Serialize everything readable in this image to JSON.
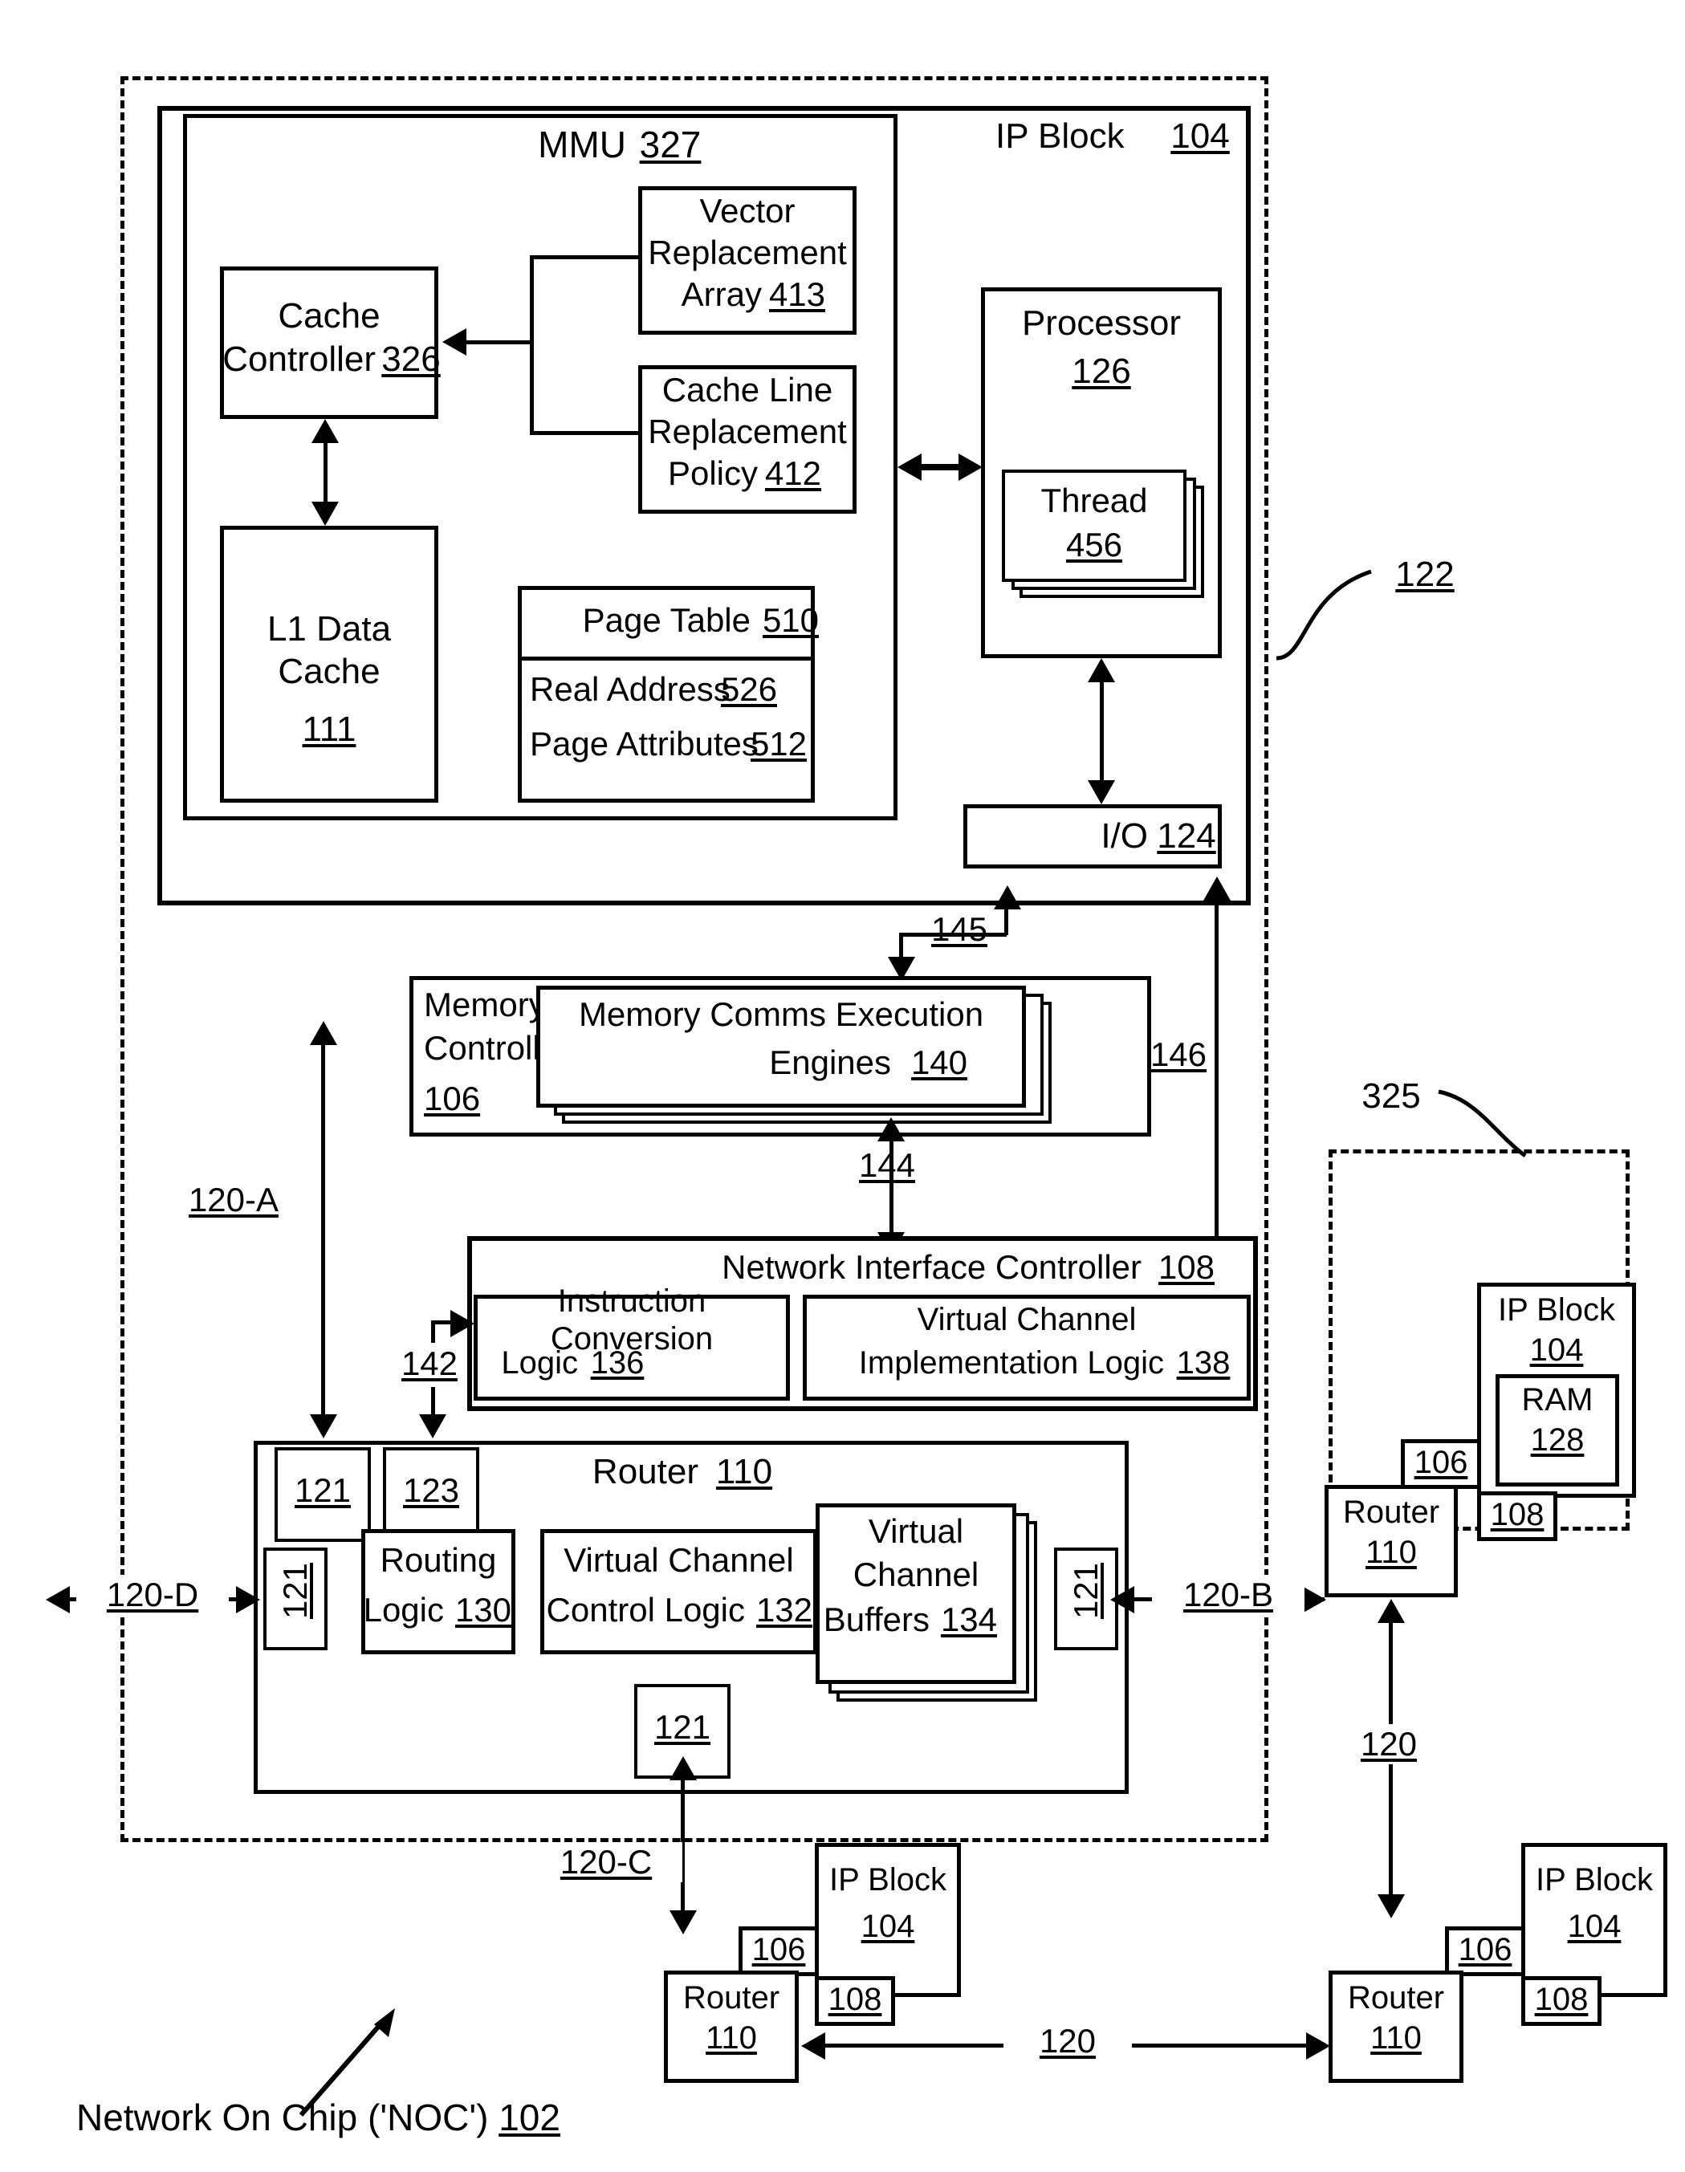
{
  "figure": {
    "caption": "Network On Chip ('NOC') 102",
    "noc_ref": "102"
  },
  "noc_boundary": {
    "name": "NOC dashed boundary"
  },
  "ip_block_main": {
    "title": "IP Block",
    "ref": "104",
    "pointer_ref": "122"
  },
  "mmu": {
    "title": "MMU",
    "ref": "327",
    "cache_controller": {
      "line1": "Cache",
      "line2": "Controller",
      "ref": "326"
    },
    "l1_cache": {
      "line1": "L1 Data",
      "line2": "Cache",
      "ref": "111"
    },
    "vector_replacement_array": {
      "line1": "Vector",
      "line2": "Replacement",
      "line3": "Array",
      "ref": "413"
    },
    "cache_line_replacement_policy": {
      "line1": "Cache Line",
      "line2": "Replacement",
      "line3": "Policy",
      "ref": "412"
    },
    "page_table": {
      "title": "Page Table",
      "ref": "510",
      "rows": [
        {
          "label": "Real Address",
          "ref": "526"
        },
        {
          "label": "Page Attributes",
          "ref": "512"
        }
      ]
    }
  },
  "processor": {
    "title": "Processor",
    "ref": "126",
    "thread": {
      "title": "Thread",
      "ref": "456"
    }
  },
  "io": {
    "title": "I/O",
    "ref": "124"
  },
  "memory_comms_controller": {
    "line1": "Memory Comms",
    "line2": "Controller",
    "ref": "106",
    "engines": {
      "line1": "Memory Comms Execution",
      "line2": "Engines",
      "ref": "140"
    }
  },
  "network_interface_controller": {
    "title": "Network Interface Controller",
    "ref": "108",
    "instruction_conversion_logic": {
      "line1": "Instruction Conversion",
      "line2": "Logic",
      "ref": "136"
    },
    "virtual_channel_implementation_logic": {
      "line1": "Virtual Channel",
      "line2": "Implementation Logic",
      "ref": "138"
    }
  },
  "router_main": {
    "title": "Router",
    "ref": "110",
    "port_top_left": "121",
    "port_top_second": "123",
    "port_left": "121",
    "port_right": "121",
    "port_bottom": "121",
    "routing_logic": {
      "line1": "Routing",
      "line2": "Logic",
      "ref": "130"
    },
    "virtual_channel_control_logic": {
      "line1": "Virtual Channel",
      "line2": "Control Logic",
      "ref": "132"
    },
    "virtual_channel_buffers": {
      "line1": "Virtual",
      "line2": "Channel",
      "line3": "Buffers",
      "ref": "134"
    }
  },
  "links": {
    "l145": "145",
    "l146": "146",
    "l144": "144",
    "l142": "142",
    "l120_a": "120-A",
    "l120_b": "120-B",
    "l120_c": "120-C",
    "l120_d": "120-D",
    "l120": "120"
  },
  "cluster_325": {
    "ref": "325",
    "ip_block": {
      "title": "IP Block",
      "ref": "104"
    },
    "ram": {
      "title": "RAM",
      "ref": "128"
    },
    "mcc_ref": "106",
    "nic_ref": "108",
    "router": {
      "title": "Router",
      "ref": "110"
    }
  },
  "node_bottom_left": {
    "ip_block": {
      "title": "IP Block",
      "ref": "104"
    },
    "mcc_ref": "106",
    "nic_ref": "108",
    "router": {
      "title": "Router",
      "ref": "110"
    }
  },
  "node_bottom_right": {
    "ip_block": {
      "title": "IP Block",
      "ref": "104"
    },
    "mcc_ref": "106",
    "nic_ref": "108",
    "router": {
      "title": "Router",
      "ref": "110"
    }
  }
}
